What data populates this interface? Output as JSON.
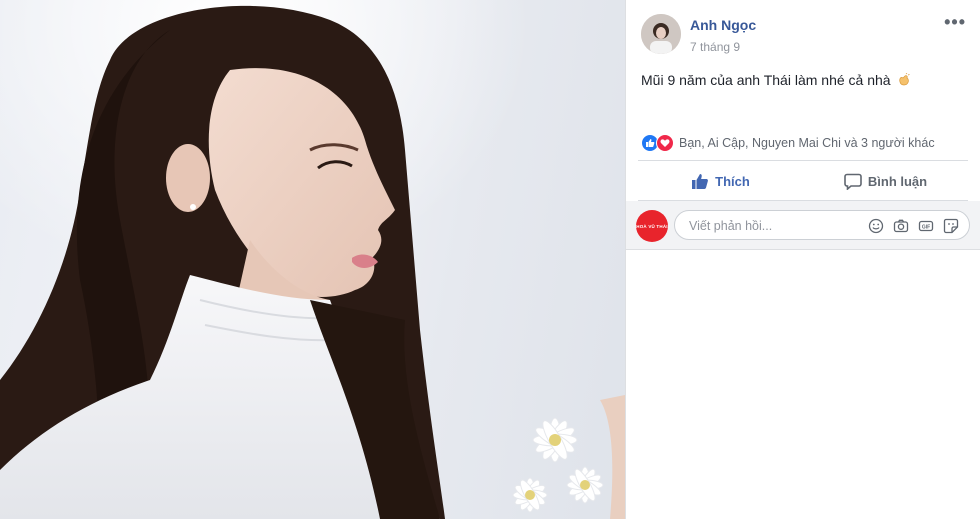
{
  "post": {
    "author": "Anh Ngọc",
    "date": "7 tháng 9",
    "text": "Mũi 9 năm của anh Thái làm nhé cả nhà",
    "text_emoji": "clapping-hands-icon",
    "more_label": "•••"
  },
  "reactions": {
    "icons": [
      "like-reaction-icon",
      "love-reaction-icon"
    ],
    "summary": "Bạn, Ai Cập, Nguyen Mai Chi và 3 người khác"
  },
  "actions": {
    "like_label": "Thích",
    "comment_label": "Bình luận"
  },
  "comment_box": {
    "avatar_text": "HOÀ VŨ THÁI",
    "placeholder": "Viết phản hồi...",
    "icons": [
      "emoji-icon",
      "camera-icon",
      "gif-icon",
      "sticker-icon"
    ]
  },
  "colors": {
    "link_blue": "#385898",
    "like_blue": "#4267b2",
    "love_red": "#f0284a",
    "avatar_red": "#e8242c"
  }
}
